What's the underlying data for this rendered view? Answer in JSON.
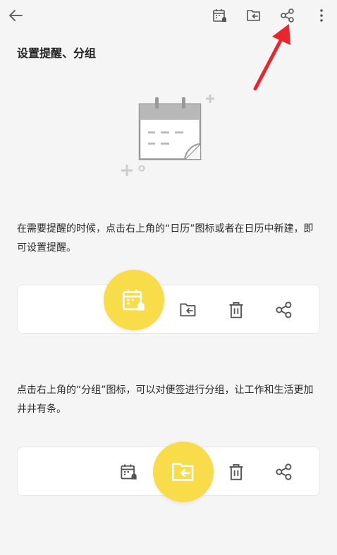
{
  "toolbar": {
    "icons": [
      "back-arrow-icon",
      "calendar-reminder-icon",
      "folder-group-icon",
      "share-icon",
      "more-vertical-icon"
    ]
  },
  "content": {
    "title": "设置提醒、分组",
    "paragraph1": "在需要提醒的时候，点击右上角的“日历”图标或者在日历中新建，即可设置提醒。",
    "paragraph2": "点击右上角的“分组”图标，可以对便签进行分组，让工作和生活更加井井有条。"
  },
  "colors": {
    "accent_yellow": "#f9dc4a",
    "annotation_arrow": "#e8262b",
    "icon_gray": "#555555"
  }
}
